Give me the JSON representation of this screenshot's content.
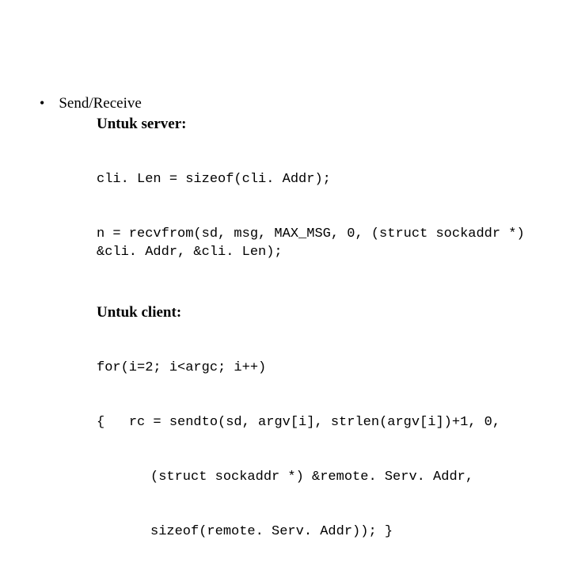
{
  "bullet": {
    "title": "Send/Receive"
  },
  "server": {
    "heading": "Untuk server:",
    "code_line1": "cli. Len = sizeof(cli. Addr);",
    "code_line2": "n = recvfrom(sd, msg, MAX_MSG, 0, (struct sockaddr *) &cli. Addr, &cli. Len);"
  },
  "client": {
    "heading": "Untuk client:",
    "code_line1": "for(i=2; i<argc; i++)",
    "code_line2_a": "{",
    "code_line2_b": "rc = sendto(sd, argv[i], strlen(argv[i])+1, 0,",
    "code_line3": "(struct sockaddr *) &remote. Serv. Addr,",
    "code_line4": "sizeof(remote. Serv. Addr)); }"
  }
}
